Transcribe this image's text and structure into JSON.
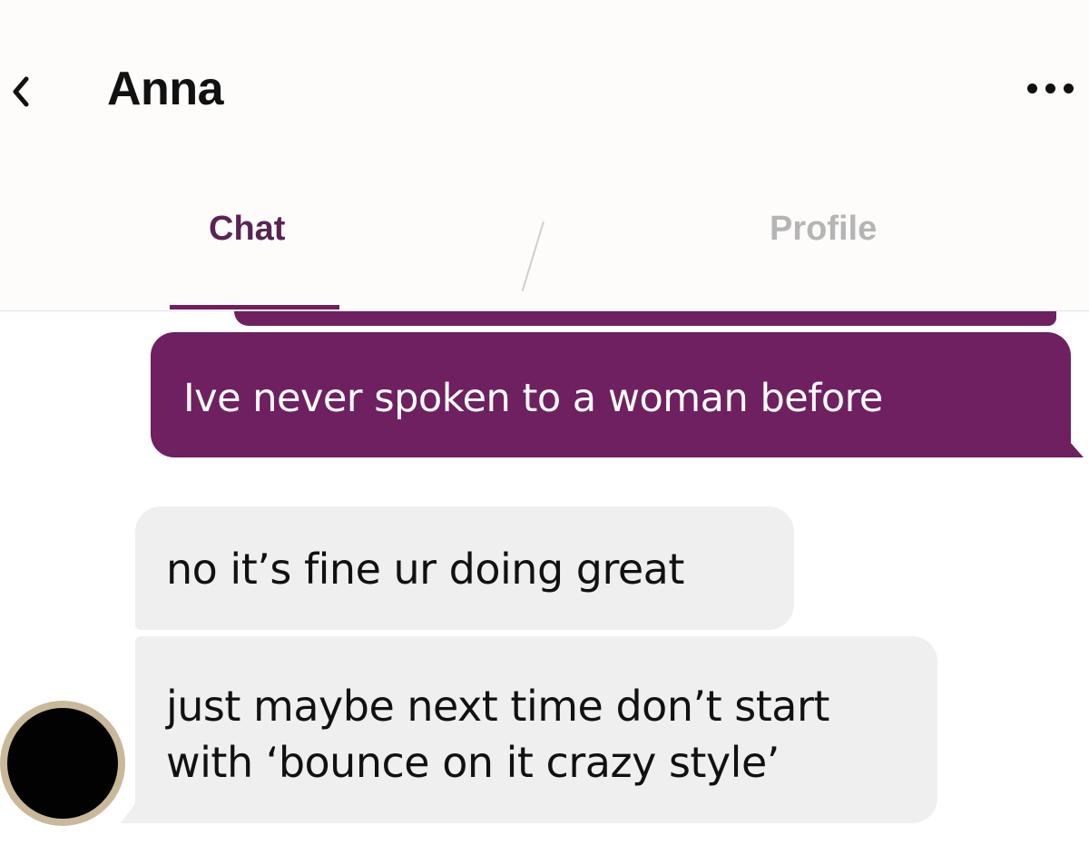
{
  "header": {
    "back_icon": "chevron-left-icon",
    "contact_name": "Anna",
    "more_icon": "more-horizontal-icon"
  },
  "tabs": [
    {
      "label": "Chat",
      "active": true
    },
    {
      "label": "Profile",
      "active": false
    }
  ],
  "colors": {
    "accent": "#6e2060",
    "incoming_bubble": "#efefef",
    "inactive_tab": "#b5b5b5"
  },
  "messages": [
    {
      "direction": "outgoing",
      "text": "Ive never spoken to a woman before"
    },
    {
      "direction": "incoming",
      "text": "no it’s fine ur doing great"
    },
    {
      "direction": "incoming",
      "lines": [
        "just maybe next time don’t start",
        "with ‘bounce on it crazy style’"
      ]
    }
  ]
}
